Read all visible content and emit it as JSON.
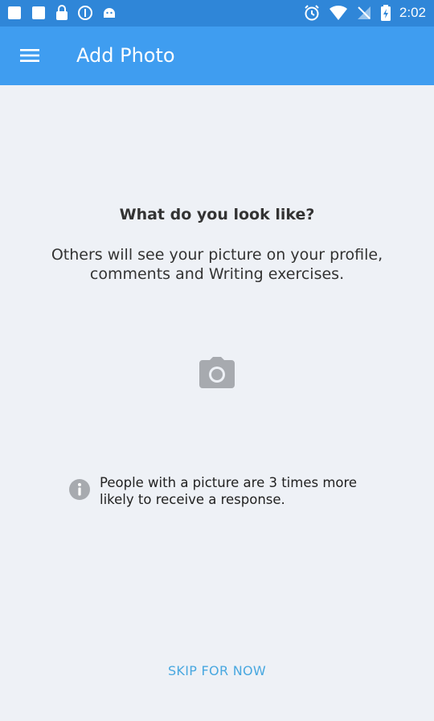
{
  "status_bar": {
    "time": "2:02",
    "icons": [
      "notification-icon",
      "notification-icon",
      "lock-icon",
      "circle-icon",
      "android-icon",
      "alarm-icon",
      "wifi-icon",
      "no-signal-icon",
      "battery-charging-icon"
    ]
  },
  "toolbar": {
    "title": "Add Photo",
    "menu_icon": "hamburger-menu-icon"
  },
  "content": {
    "headline": "What do you look like?",
    "subtext": "Others will see your picture on your profile, comments and Writing exercises.",
    "camera_icon": "camera-icon",
    "tip_icon": "info-icon",
    "tip_text": "People with a picture are 3 times more likely to receive a response.",
    "skip_label": "SKIP FOR NOW"
  },
  "colors": {
    "status_bar": "#2f86d8",
    "toolbar": "#3f9df0",
    "background": "#eef1f6",
    "accent": "#49a8e0",
    "icon_gray": "#a7aaaf"
  }
}
